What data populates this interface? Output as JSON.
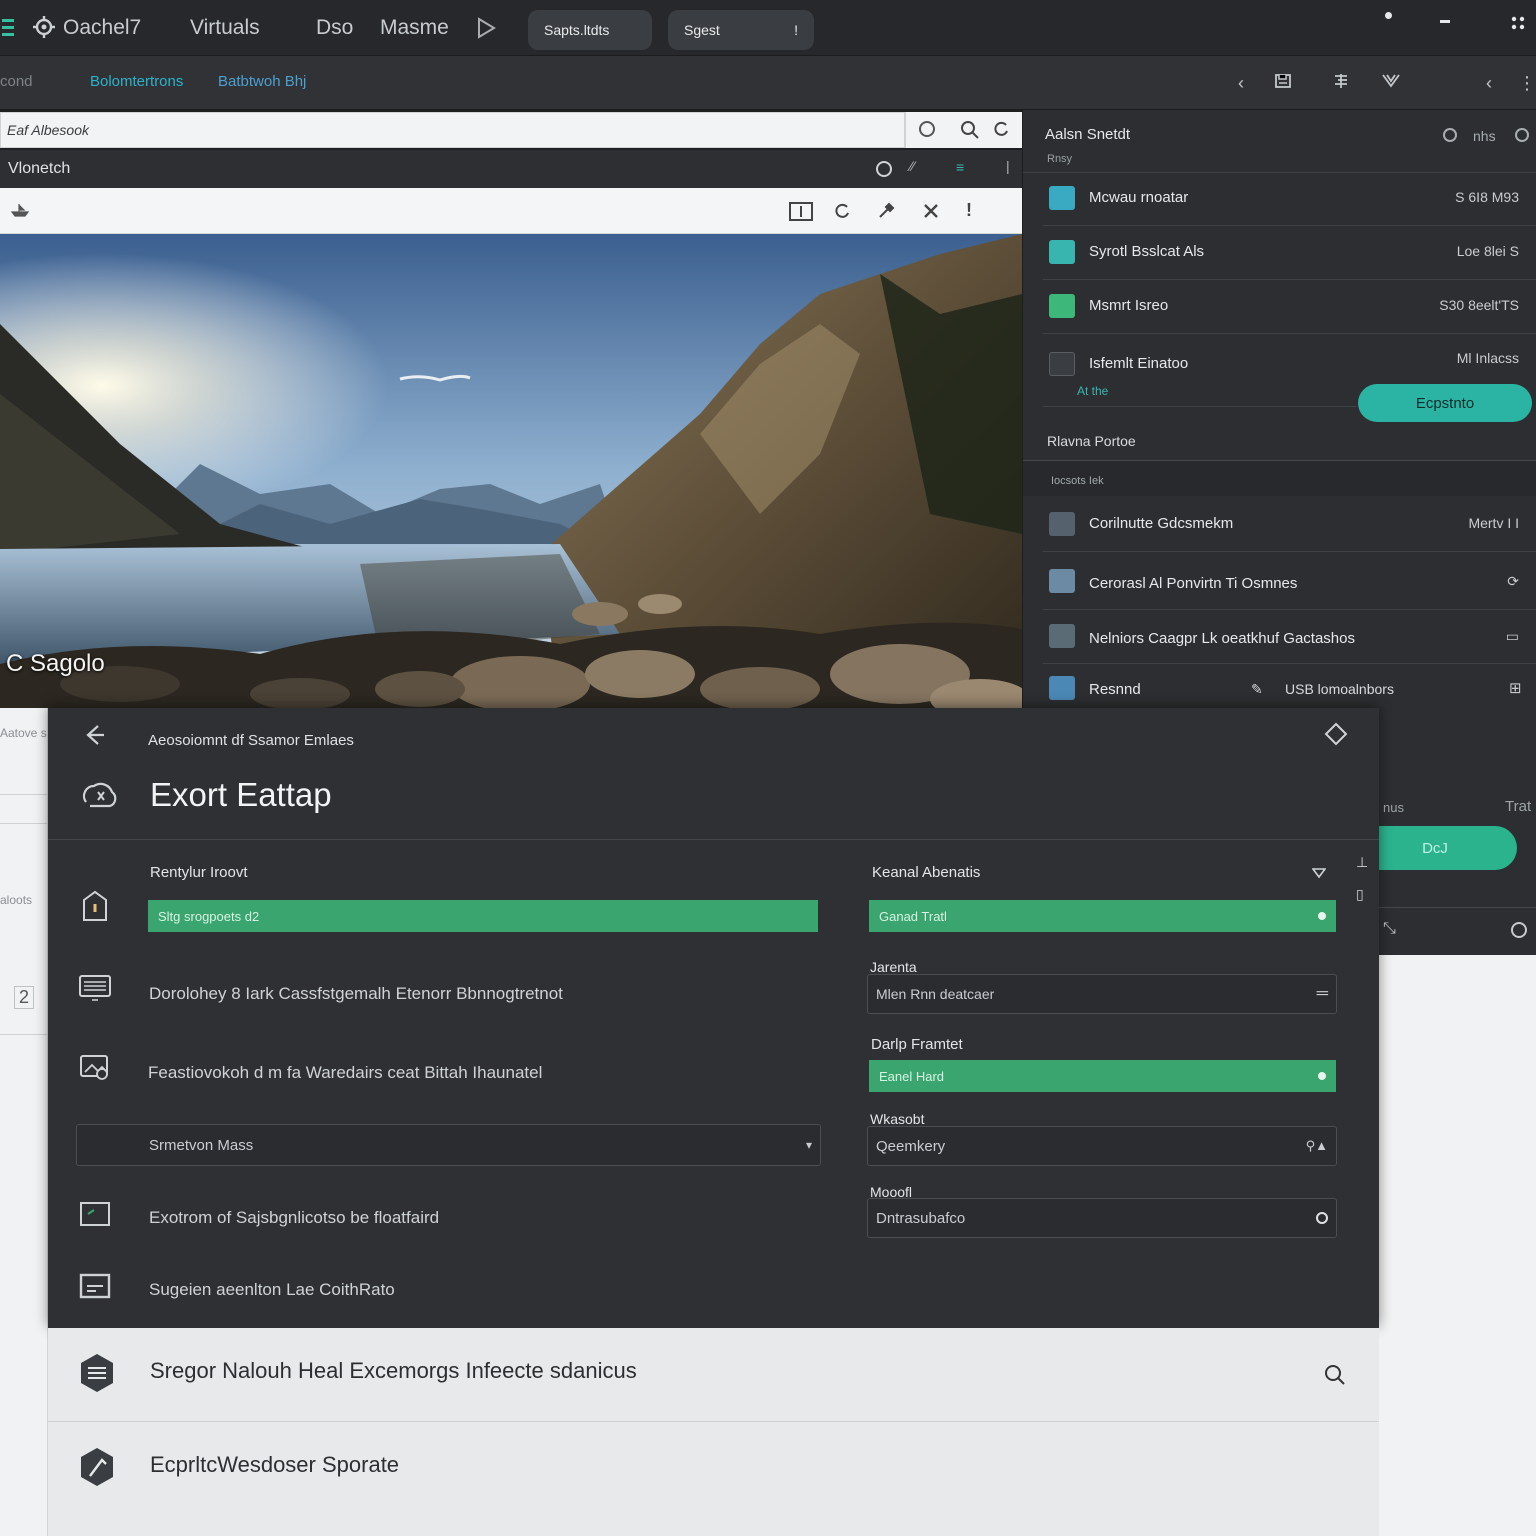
{
  "topbar": {
    "app_name": "Oachel7",
    "menus": [
      "Virtuals",
      "Dso",
      "Masme"
    ],
    "pill1": "Sapts.ltdts",
    "pill2": "Sgest",
    "pill2_suffix": "!"
  },
  "crumbbar": {
    "left_text": "cond",
    "crumb1": "Bolomtertrons",
    "crumb2": "Batbtwoh Bhj"
  },
  "viewer": {
    "search_value": "Eaf Albesook",
    "title": "Vlonetch",
    "caption": "C Sagolo"
  },
  "rightpanel": {
    "title": "Aalsn Snetdt",
    "subtitle": "Rnsy",
    "header_right": "nhs",
    "rows": [
      {
        "name": "Mcwau rnoatar",
        "value": "S 6I8 M93",
        "color": "#3aa9c2"
      },
      {
        "name": "Syrotl Bsslcat Als",
        "value": "Loe 8lei S",
        "color": "#39b5b0"
      },
      {
        "name": "Msmrt Isreo",
        "value": "S30 8eelt'TS",
        "color": "#3db87a"
      },
      {
        "name": "Isfemlt Einatoo",
        "value": "Ml Inlacss",
        "color": "#4a4d52"
      }
    ],
    "row4_sub": "At the",
    "export_button": "Ecpstnto",
    "section_label": "Rlavna Portoe",
    "subsection_label": "Iocsots Iek",
    "list": [
      {
        "name": "Corilnutte Gdcsmekm",
        "value": "Mertv I I"
      },
      {
        "name": "Cerorasl Al Ponvirtn Ti Osmnes",
        "value": "⟳"
      },
      {
        "name": "Nelniors Caagpr Lk oeatkhuf Gactashos",
        "value": "▭"
      },
      {
        "name": "Resnnd",
        "value": "USB lomoalnbors"
      }
    ],
    "lower_left": "nus",
    "lower_right": "Trat",
    "lower_button": "DcJ"
  },
  "dialog": {
    "crumb": "Aeosoiomnt df Ssamor Emlaes",
    "title": "Exort Eattap",
    "left": {
      "field1_label": "Rentylur Iroovt",
      "field1_value": "Sltg srogpoets d2",
      "item1": "Dorolohey 8 Iark Cassfstgemalh Etenorr Bbnnogtretnot",
      "item2": "Feastiovokoh d m fa Waredairs ceat Bittah Ihaunatel",
      "select_value": "Srmetvon Mass",
      "item3": "Exotrom of Sajsbgnlicotso be floatfaird",
      "item4": "Sugeien aeenlton Lae CoithRato"
    },
    "right": {
      "field1_label": "Keanal Abenatis",
      "field1_value": "Ganad Tratl",
      "field2_label": "Jarenta",
      "field2_value": "Mlen Rnn deatcaer",
      "field3_label": "Darlp Framtet",
      "field3_value": "Eanel Hard",
      "field4_label": "Wkasobt",
      "field4_value": "Qeemkery",
      "field5_label": "Mooofl",
      "field5_value": "Dntrasubafco"
    }
  },
  "bottomlist": {
    "row1": "Sregor Nalouh Heal Excemorgs Infeecte sdanicus",
    "row2": "EcprltcWesdoser Sporate"
  },
  "sheet_left": [
    "Aatove s",
    "aloots",
    "2"
  ],
  "colors": {
    "accent_green": "#3aa56e",
    "accent_teal": "#2bb3a3",
    "dark_bg": "#2e3034"
  }
}
